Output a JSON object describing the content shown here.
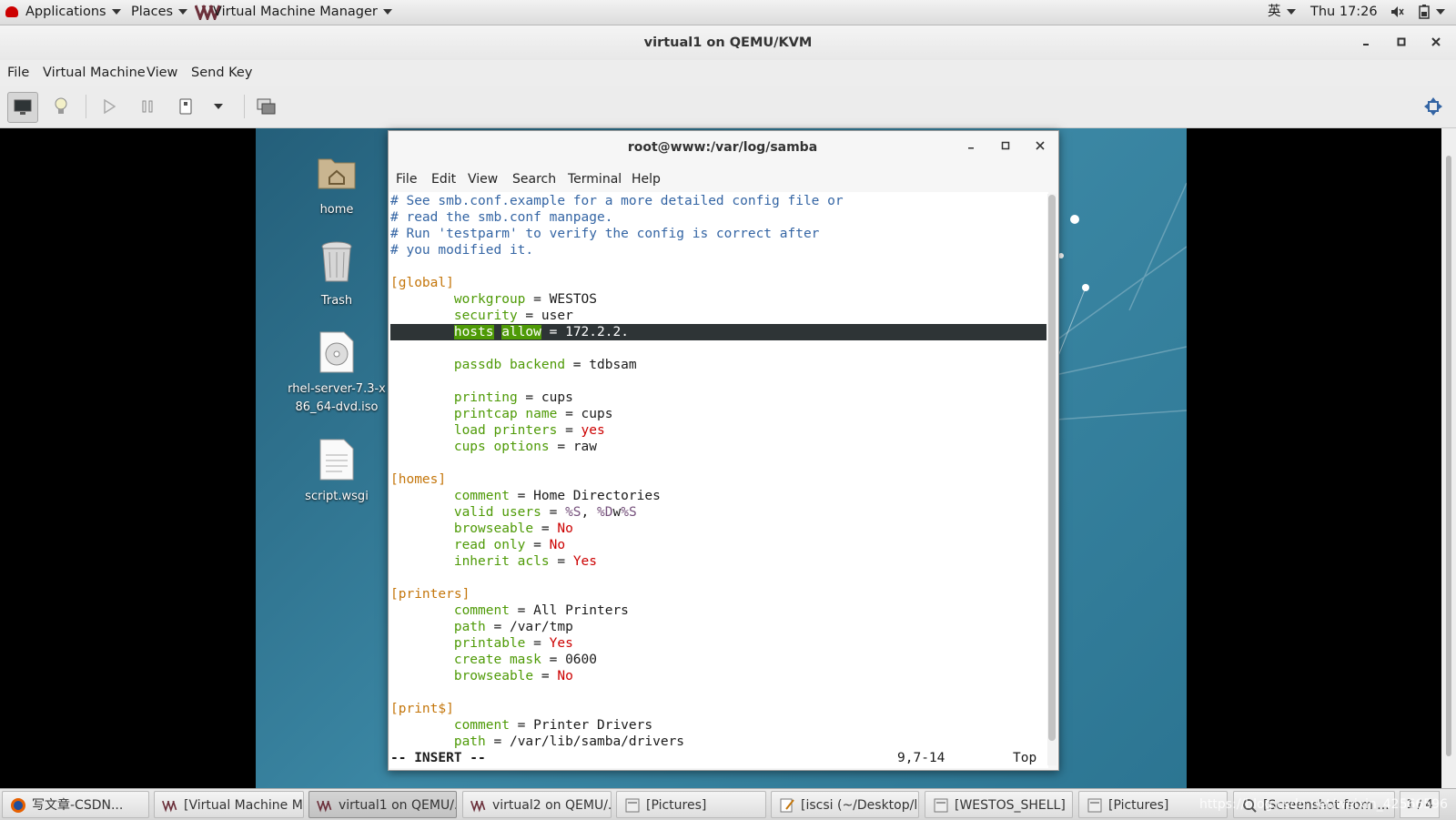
{
  "top_panel": {
    "applications": "Applications",
    "places": "Places",
    "app_name": "Virtual Machine Manager",
    "input_method": "英",
    "clock": "Thu 17:26"
  },
  "vm_window": {
    "title": "virtual1 on QEMU/KVM",
    "menu": [
      "File",
      "Virtual Machine",
      "View",
      "Send Key"
    ]
  },
  "desktop_icons": [
    {
      "label": "home",
      "icon": "folder-home-icon"
    },
    {
      "label": "Trash",
      "icon": "trash-icon"
    },
    {
      "label": "rhel-server-7.3-x86_64-dvd.iso",
      "icon": "disc-image-icon"
    },
    {
      "label": "script.wsgi",
      "icon": "text-file-icon"
    }
  ],
  "terminal": {
    "title": "root@www:/var/log/samba",
    "menu": [
      "File",
      "Edit",
      "View",
      "Search",
      "Terminal",
      "Help"
    ],
    "lines": {
      "l1": "# See smb.conf.example for a more detailed config file or",
      "l2": "# read the smb.conf manpage.",
      "l3": "# Run 'testparm' to verify the config is correct after",
      "l4": "# you modified it.",
      "global": "[global]",
      "workgroup_key": "workgroup",
      "workgroup_val": "WESTOS",
      "security_key": "security",
      "security_val": "user",
      "hosts_key": "hosts",
      "allow_key": "allow",
      "hosts_val": "172.2.2.",
      "passdb_key": "passdb backend",
      "passdb_val": "tdbsam",
      "printing_key": "printing",
      "printing_val": "cups",
      "printcap_key": "printcap name",
      "printcap_val": "cups",
      "loadprinters_key": "load printers",
      "loadprinters_val": "yes",
      "cupsopt_key": "cups options",
      "cupsopt_val": "raw",
      "homes": "[homes]",
      "comment1_key": "comment",
      "comment1_val": "Home Directories",
      "validusers_key": "valid users",
      "validusers_v1": "%S",
      "validusers_sep": ", ",
      "validusers_v2": "%D",
      "validusers_w": "w",
      "validusers_v3": "%S",
      "browse1_key": "browseable",
      "browse1_val": "No",
      "readonly_key": "read only",
      "readonly_val": "No",
      "inherit_key": "inherit acls",
      "inherit_val": "Yes",
      "printers": "[printers]",
      "comment2_key": "comment",
      "comment2_val": "All Printers",
      "path1_key": "path",
      "path1_val": "/var/tmp",
      "printable_key": "printable",
      "printable_val": "Yes",
      "mask_key": "create mask",
      "mask_val": "0600",
      "browse2_key": "browseable",
      "browse2_val": "No",
      "printdollar": "[print$]",
      "comment3_key": "comment",
      "comment3_val": "Printer Drivers",
      "path2_key": "path",
      "path2_val": "/var/lib/samba/drivers"
    },
    "status": {
      "mode": "-- INSERT --",
      "position": "9,7-14",
      "scroll": "Top"
    }
  },
  "taskbar": {
    "items": [
      {
        "label": "写文章-CSDN...",
        "icon": "firefox-icon"
      },
      {
        "label": "[Virtual Machine M...",
        "icon": "virt-manager-icon"
      },
      {
        "label": "virtual1 on QEMU/...",
        "icon": "virt-manager-icon"
      },
      {
        "label": "virtual2 on QEMU/...",
        "icon": "virt-manager-icon"
      },
      {
        "label": "[Pictures]",
        "icon": "file-manager-icon"
      },
      {
        "label": "[iscsi (~/Desktop/l...",
        "icon": "text-editor-icon"
      },
      {
        "label": "[WESTOS_SHELL]",
        "icon": "file-manager-icon"
      },
      {
        "label": "[Pictures]",
        "icon": "file-manager-icon"
      },
      {
        "label": "[Screenshot from ...",
        "icon": "screenshot-icon"
      }
    ],
    "pager": "1 / 4",
    "watermark": "https://blog.csdn.net/weixin_42566596"
  }
}
